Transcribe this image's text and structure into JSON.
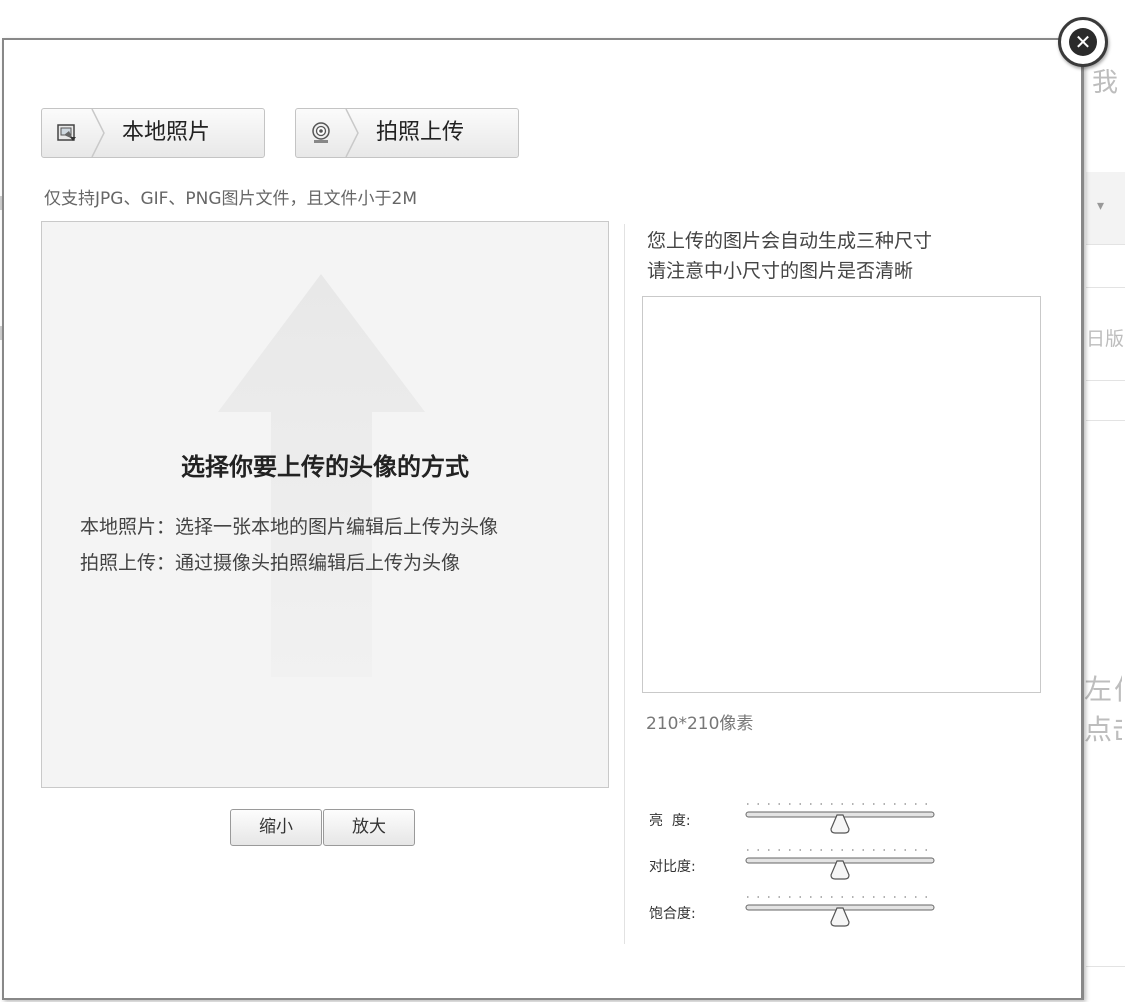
{
  "background": {
    "snippets": [
      "我",
      "日版",
      "左伯",
      "点击"
    ]
  },
  "dialog": {
    "close_icon": "close-circle-icon",
    "tabs": [
      {
        "label": "本地照片",
        "icon": "local-photo-icon"
      },
      {
        "label": "拍照上传",
        "icon": "webcam-icon"
      }
    ],
    "hint": "仅支持JPG、GIF、PNG图片文件，且文件小于2M",
    "image_area": {
      "title": "选择你要上传的头像的方式",
      "line1": "本地照片：选择一张本地的图片编辑后上传为头像",
      "line2": "拍照上传：通过摄像头拍照编辑后上传为头像"
    },
    "zoom": {
      "shrink_label": "缩小",
      "enlarge_label": "放大"
    },
    "preview": {
      "line1": "您上传的图片会自动生成三种尺寸",
      "line2": "请注意中小尺寸的图片是否清晰",
      "size_label": "210*210像素"
    },
    "sliders": [
      {
        "label": "亮  度:",
        "value": 0.5
      },
      {
        "label": "对比度:",
        "value": 0.5
      },
      {
        "label": "饱合度:",
        "value": 0.5
      }
    ]
  }
}
